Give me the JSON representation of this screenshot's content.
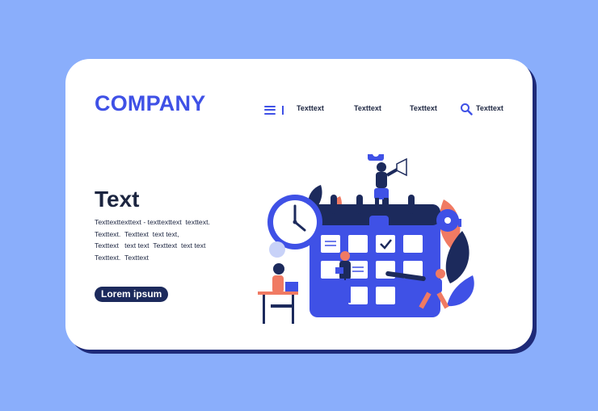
{
  "header": {
    "logo": "COMPANY",
    "nav": [
      "Texttext",
      "Texttext",
      "Texttext"
    ],
    "search_label": "Texttext"
  },
  "hero": {
    "title": "Text",
    "body_lines": [
      "Texttexttexttext - texttexttext  texttext.",
      "Texttext.  Texttext  text text,",
      "Texttext   text text  Texttext  text text",
      "Texttext.  Texttext"
    ],
    "cta_label": "Lorem ipsum"
  },
  "colors": {
    "background": "#8aaefb",
    "card": "#ffffff",
    "accent": "#3f51e6",
    "dark_navy": "#1c2a5c",
    "coral": "#f07a63"
  },
  "icons": [
    "menu-icon",
    "search-icon",
    "gear-icon",
    "megaphone-icon",
    "clock-icon",
    "checkmark-icon",
    "laptop-icon"
  ]
}
